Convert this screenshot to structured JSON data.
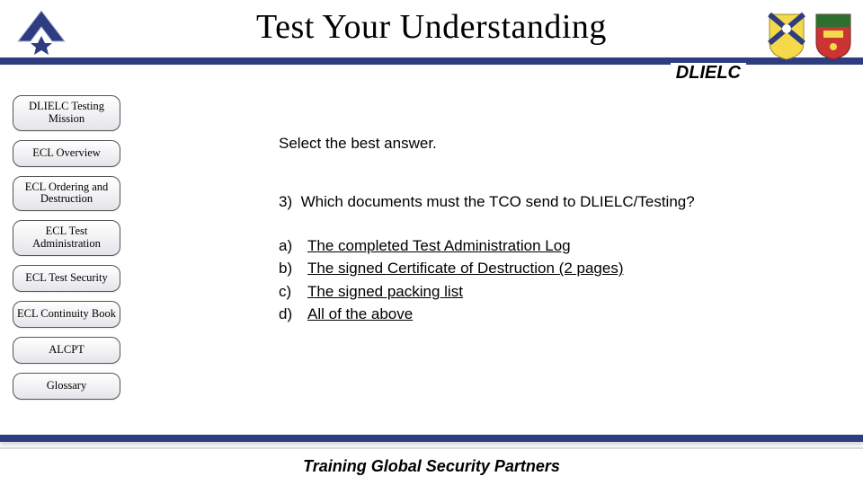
{
  "header": {
    "title": "Test Your Understanding",
    "subbrand": "DLIELC"
  },
  "sidebar": {
    "items": [
      "DLIELC Testing Mission",
      "ECL Overview",
      "ECL Ordering and Destruction",
      "ECL Test Administration",
      "ECL Test Security",
      "ECL Continuity Book",
      "ALCPT",
      "Glossary"
    ]
  },
  "content": {
    "prompt": "Select the best answer.",
    "question_number": "3)",
    "question_text": "Which documents must the TCO send to DLIELC/Testing?",
    "options": [
      {
        "letter": "a)",
        "text": "The completed Test Administration Log"
      },
      {
        "letter": "b)",
        "text": "The signed Certificate of Destruction (2 pages)"
      },
      {
        "letter": "c)",
        "text": "The signed packing list"
      },
      {
        "letter": "d)",
        "text": "All of the above"
      }
    ]
  },
  "footer": {
    "text": "Training Global Security Partners"
  },
  "icons": {
    "af_wing": "air-force-wing-icon",
    "crest_left": "flag-crest-icon",
    "crest_right": "unit-crest-icon"
  }
}
